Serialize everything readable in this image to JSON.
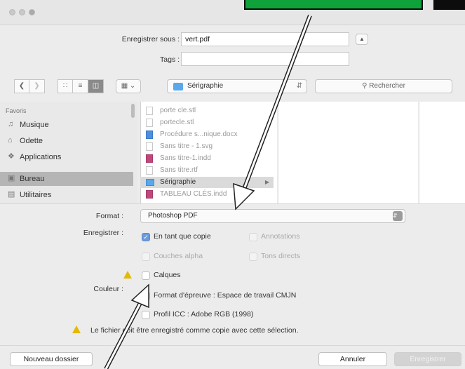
{
  "window": {
    "save_as_label": "Enregistrer sous :",
    "filename": "vert.pdf",
    "tags_label": "Tags :",
    "tags_value": ""
  },
  "toolbar": {
    "back_icon": "chevron-left-icon",
    "forward_icon": "chevron-right-icon",
    "location": "Sérigraphie",
    "search_placeholder": "Rechercher"
  },
  "sidebar": {
    "heading": "Favoris",
    "items": [
      {
        "label": "Musique",
        "icon": "music-icon"
      },
      {
        "label": "Odette",
        "icon": "home-icon"
      },
      {
        "label": "Applications",
        "icon": "applications-icon"
      },
      {
        "label": "Bureau",
        "icon": "desktop-icon",
        "selected": true
      },
      {
        "label": "Utilitaires",
        "icon": "folder-icon"
      }
    ]
  },
  "files": [
    {
      "name": "porte cle.stl",
      "icon": "doc"
    },
    {
      "name": "portecle.stl",
      "icon": "doc"
    },
    {
      "name": "Procédure s...nique.docx",
      "icon": "blue"
    },
    {
      "name": "Sans titre - 1.svg",
      "icon": "doc"
    },
    {
      "name": "Sans titre-1.indd",
      "icon": "pink"
    },
    {
      "name": "Sans titre.rtf",
      "icon": "doc"
    },
    {
      "name": "Sérigraphie",
      "icon": "folder",
      "selected": true
    },
    {
      "name": "TABLEAU CLÉS.indd",
      "icon": "pink"
    }
  ],
  "options": {
    "format_label": "Format :",
    "format_value": "Photoshop PDF",
    "save_label": "Enregistrer :",
    "as_copy": "En tant que copie",
    "annotations": "Annotations",
    "alpha_channels": "Couches alpha",
    "spot_colors": "Tons directs",
    "layers": "Calques",
    "color_label": "Couleur :",
    "proof_format": "Format d'épreuve : Espace de travail CMJN",
    "icc_profile": "Profil ICC : Adobe RGB (1998)",
    "warning": "Le fichier doit être enregistré comme copie avec cette sélection."
  },
  "buttons": {
    "new_folder": "Nouveau dossier",
    "cancel": "Annuler",
    "save": "Enregistrer"
  },
  "colors": {
    "arrow": "#ffffff",
    "accent": "#6b9cdd",
    "overlay_green": "#10a23a"
  }
}
